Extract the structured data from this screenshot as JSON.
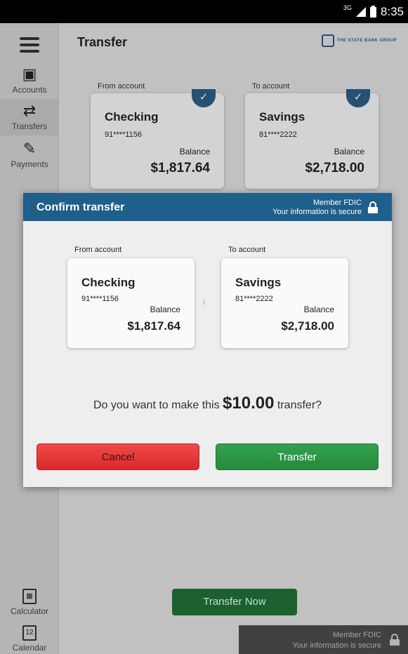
{
  "status_bar": {
    "network": "3G",
    "time": "8:35"
  },
  "sidebar": {
    "items": [
      {
        "label": "Accounts",
        "icon": "card-icon"
      },
      {
        "label": "Transfers",
        "icon": "transfer-arrows-icon"
      },
      {
        "label": "Payments",
        "icon": "pay-pen-icon"
      }
    ],
    "bottom_items": [
      {
        "label": "Calculator",
        "icon": "calculator-icon"
      },
      {
        "label": "Calendar",
        "icon": "calendar-icon",
        "icon_text": "12"
      }
    ]
  },
  "header": {
    "title": "Transfer",
    "brand": "THE STATE BANK GROUP"
  },
  "background_form": {
    "from": {
      "label": "From account",
      "name": "Checking",
      "number": "91****1156",
      "balance_label": "Balance",
      "balance": "$1,817.64"
    },
    "to": {
      "label": "To account",
      "name": "Savings",
      "number": "81****2222",
      "balance_label": "Balance",
      "balance": "$2,718.00"
    },
    "transfer_now": "Transfer Now",
    "footer": {
      "line1": "Member FDIC",
      "line2": "Your information is secure"
    }
  },
  "modal": {
    "title": "Confirm transfer",
    "fdic_line1": "Member FDIC",
    "fdic_line2": "Your information is secure",
    "from": {
      "label": "From account",
      "name": "Checking",
      "number": "91****1156",
      "balance_label": "Balance",
      "balance": "$1,817.64"
    },
    "to": {
      "label": "To account",
      "name": "Savings",
      "number": "81****2222",
      "balance_label": "Balance",
      "balance": "$2,718.00"
    },
    "question_prefix": "Do you want to make this",
    "amount": "$10.00",
    "question_suffix": "transfer?",
    "cancel_label": "Cancel",
    "transfer_label": "Transfer"
  },
  "colors": {
    "header_blue": "#1f5f8b",
    "cancel_red": "#e03535",
    "transfer_green": "#2c9a48",
    "transfer_now_green": "#1f6e35"
  }
}
